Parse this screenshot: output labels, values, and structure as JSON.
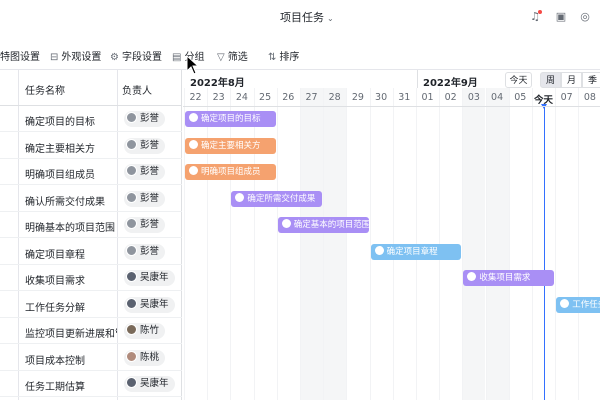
{
  "header": {
    "title": "项目任务",
    "title_chevron_icon": "chevron-down-icon",
    "icons": [
      "bell-icon",
      "box-icon",
      "compass-icon"
    ],
    "accent_color": "#3370ff"
  },
  "toolbar": {
    "items": [
      {
        "label": "甘特图设置",
        "visible_label": "特图设置",
        "icon": "gantt-settings-icon"
      },
      {
        "label": "外观设置",
        "icon": "appearance-icon"
      },
      {
        "label": "字段设置",
        "icon": "field-settings-icon"
      },
      {
        "label": "分组",
        "icon": "group-icon"
      },
      {
        "label": "筛选",
        "icon": "filter-icon"
      },
      {
        "label": "排序",
        "icon": "sort-icon"
      }
    ]
  },
  "table": {
    "columns": {
      "name": "任务名称",
      "owner": "负责人"
    },
    "rows": [
      {
        "name": "确定项目的目标",
        "owner": "彭誉"
      },
      {
        "name": "确定主要相关方",
        "owner": "彭誉"
      },
      {
        "name": "明确项目组成员",
        "owner": "彭誉"
      },
      {
        "name": "确认所需交付成果",
        "owner": "彭誉"
      },
      {
        "name": "明确基本的项目范围",
        "owner": "彭誉"
      },
      {
        "name": "确定项目章程",
        "owner": "彭誉"
      },
      {
        "name": "收集项目需求",
        "owner": "吴康年"
      },
      {
        "name": "工作任务分解",
        "owner": "吴康年"
      },
      {
        "name": "监控项目更新进展和管",
        "owner": "陈竹"
      },
      {
        "name": "项目成本控制",
        "owner": "陈桃"
      },
      {
        "name": "任务工期估算",
        "owner": "吴康年"
      }
    ]
  },
  "timeline": {
    "months": [
      "2022年8月",
      "2022年9月"
    ],
    "days": [
      "22",
      "23",
      "24",
      "25",
      "26",
      "27",
      "28",
      "29",
      "30",
      "31",
      "01",
      "02",
      "03",
      "04",
      "05",
      "今天",
      "07",
      "08"
    ],
    "today_label": "今天",
    "today_button": "今天",
    "view_buttons": [
      "周",
      "月",
      "季"
    ],
    "active_view": "周"
  },
  "bars": [
    {
      "label": "确定项目的目标",
      "color": "#a98ff5"
    },
    {
      "label": "确定主要相关方",
      "color": "#f5a26f"
    },
    {
      "label": "明确项目组成员",
      "color": "#f5a26f"
    },
    {
      "label": "确定所需交付成果",
      "color": "#a98ff5"
    },
    {
      "label": "确定基本的项目范围",
      "color": "#a98ff5"
    },
    {
      "label": "确定项目章程",
      "color": "#7ec1f2"
    },
    {
      "label": "收集项目需求",
      "color": "#a98ff5"
    },
    {
      "label": "工作任务",
      "color": "#7ec1f2"
    }
  ]
}
